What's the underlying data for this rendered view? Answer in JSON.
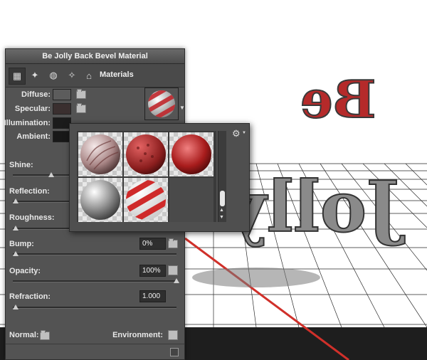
{
  "panel": {
    "title": "Be Jolly Back Bevel Material",
    "tab_label": "Materials"
  },
  "colors": {
    "diffuse": "#5c5c5c",
    "specular": "#3a2f2f",
    "illumination": "#1b1b1b",
    "ambient": "#181818"
  },
  "labels": {
    "diffuse": "Diffuse:",
    "specular": "Specular:",
    "illumination": "Illumination:",
    "ambient": "Ambient:",
    "shine": "Shine:",
    "reflection": "Reflection:",
    "roughness": "Roughness:",
    "bump": "Bump:",
    "opacity": "Opacity:",
    "refraction": "Refraction:",
    "normal": "Normal:",
    "environment": "Environment:"
  },
  "values": {
    "bump": "0%",
    "opacity": "100%",
    "refraction": "1.000"
  },
  "slider_levels": {
    "shine": 0.2,
    "reflection": 0.0,
    "roughness": 0.0,
    "bump": 0.0,
    "opacity": 1.0,
    "refraction": 0.0
  },
  "scene_text": "Be Jolly",
  "icons": {
    "tabs": [
      "scene-icon",
      "light-icon",
      "material-icon",
      "mesh-icon",
      "camera-icon"
    ],
    "popup_menu": "gear-icon"
  }
}
